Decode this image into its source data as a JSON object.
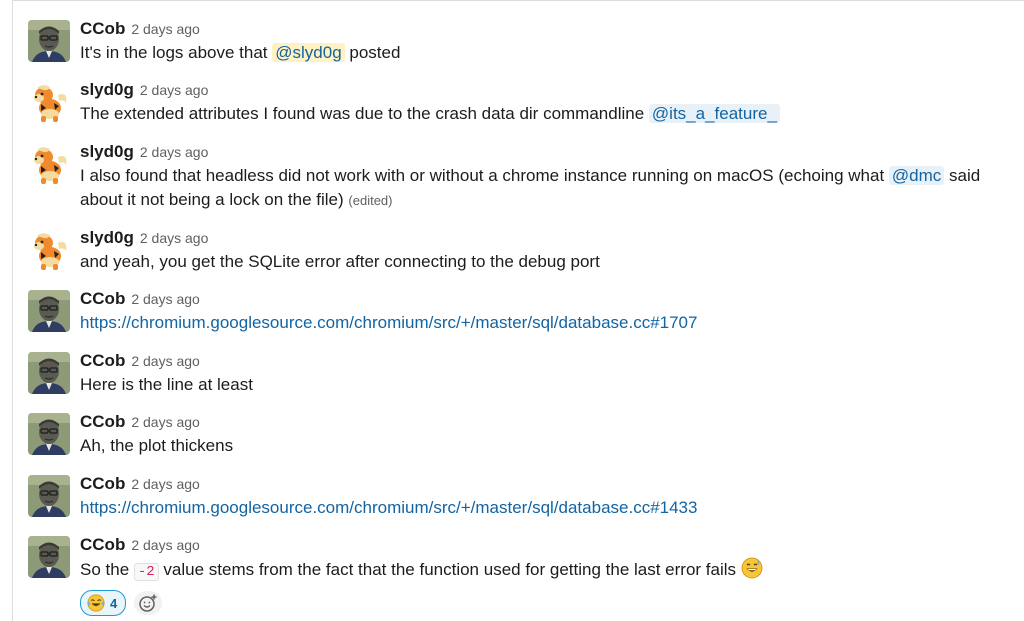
{
  "messages": [
    {
      "author": "CCob",
      "timestamp": "2 days ago",
      "avatar": "ccob-avatar",
      "parts": [
        {
          "t": "text",
          "v": "It's in the logs above that "
        },
        {
          "t": "mention",
          "v": "@slyd0g"
        },
        {
          "t": "text",
          "v": " posted"
        }
      ]
    },
    {
      "author": "slyd0g",
      "timestamp": "2 days ago",
      "avatar": "growlithe-avatar",
      "parts": [
        {
          "t": "text",
          "v": "The extended attributes I found was due to the crash data dir commandline "
        },
        {
          "t": "mention-blue",
          "v": "@its_a_feature_"
        }
      ]
    },
    {
      "author": "slyd0g",
      "timestamp": "2 days ago",
      "avatar": "growlithe-avatar",
      "parts": [
        {
          "t": "text",
          "v": "I also found that headless did not work with or without a chrome instance running on macOS (echoing what "
        },
        {
          "t": "mention-blue",
          "v": "@dmc"
        },
        {
          "t": "text",
          "v": " said about it not being a lock on the file) "
        },
        {
          "t": "edited",
          "v": "(edited)"
        }
      ]
    },
    {
      "author": "slyd0g",
      "timestamp": "2 days ago",
      "avatar": "growlithe-avatar",
      "parts": [
        {
          "t": "text",
          "v": "and yeah, you get the SQLite error after connecting to the debug port"
        }
      ]
    },
    {
      "author": "CCob",
      "timestamp": "2 days ago",
      "avatar": "ccob-avatar",
      "parts": [
        {
          "t": "link",
          "v": "https://chromium.googlesource.com/chromium/src/+/master/sql/database.cc#1707"
        }
      ]
    },
    {
      "author": "CCob",
      "timestamp": "2 days ago",
      "avatar": "ccob-avatar",
      "parts": [
        {
          "t": "text",
          "v": "Here is the line at least"
        }
      ]
    },
    {
      "author": "CCob",
      "timestamp": "2 days ago",
      "avatar": "ccob-avatar",
      "parts": [
        {
          "t": "text",
          "v": "Ah, the plot thickens"
        }
      ]
    },
    {
      "author": "CCob",
      "timestamp": "2 days ago",
      "avatar": "ccob-avatar",
      "parts": [
        {
          "t": "link",
          "v": "https://chromium.googlesource.com/chromium/src/+/master/sql/database.cc#1433"
        }
      ]
    },
    {
      "author": "CCob",
      "timestamp": "2 days ago",
      "avatar": "ccob-avatar",
      "parts": [
        {
          "t": "text",
          "v": "So the "
        },
        {
          "t": "code",
          "v": "-2"
        },
        {
          "t": "text",
          "v": " value stems from the fact that the function used for getting the last error fails "
        },
        {
          "t": "emoji",
          "v": "grinning-sweat-emoji"
        }
      ],
      "reactions": [
        {
          "emoji": "joy-emoji",
          "count": "4"
        }
      ],
      "add_reaction_icon": "add-reaction-icon"
    }
  ],
  "colors": {
    "link": "#1264a3",
    "mention_bg": "#fff1c2",
    "mention_blue_bg": "#e8f1f8",
    "code": "#e01e5a",
    "reaction_border": "#1d9bd1"
  }
}
